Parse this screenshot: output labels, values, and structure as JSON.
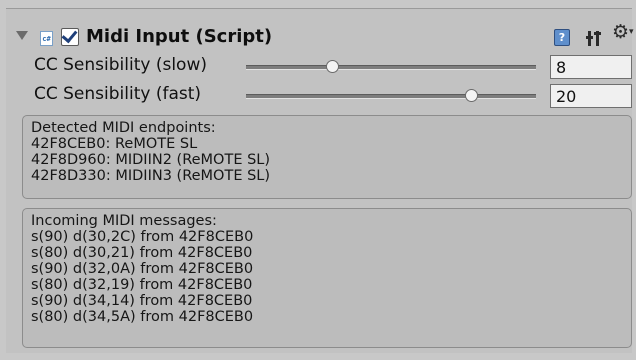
{
  "header": {
    "title": "Midi Input (Script)",
    "script_icon_text": "c#",
    "enabled": true,
    "help_icon_text": "?"
  },
  "sliders": [
    {
      "label": "CC Sensibility (slow)",
      "value": "8",
      "fraction": 0.3
    },
    {
      "label": "CC Sensibility (fast)",
      "value": "20",
      "fraction": 0.78
    }
  ],
  "endpoints": {
    "lines": [
      "Detected MIDI endpoints:",
      "42F8CEB0: ReMOTE SL",
      "42F8D960: MIDIIN2 (ReMOTE SL)",
      "42F8D330: MIDIIN3 (ReMOTE SL)"
    ]
  },
  "messages": {
    "lines": [
      "Incoming MIDI messages:",
      "s(90) d(30,2C) from 42F8CEB0",
      "s(80) d(30,21) from 42F8CEB0",
      "s(90) d(32,0A) from 42F8CEB0",
      "s(80) d(32,19) from 42F8CEB0",
      "s(90) d(34,14) from 42F8CEB0",
      "s(80) d(34,5A) from 42F8CEB0"
    ]
  },
  "icons": {
    "foldout": "foldout-arrow-icon",
    "script": "csharp-script-icon",
    "help": "help-book-icon",
    "presets": "presets-sliders-icon",
    "settings": "gear-icon"
  }
}
